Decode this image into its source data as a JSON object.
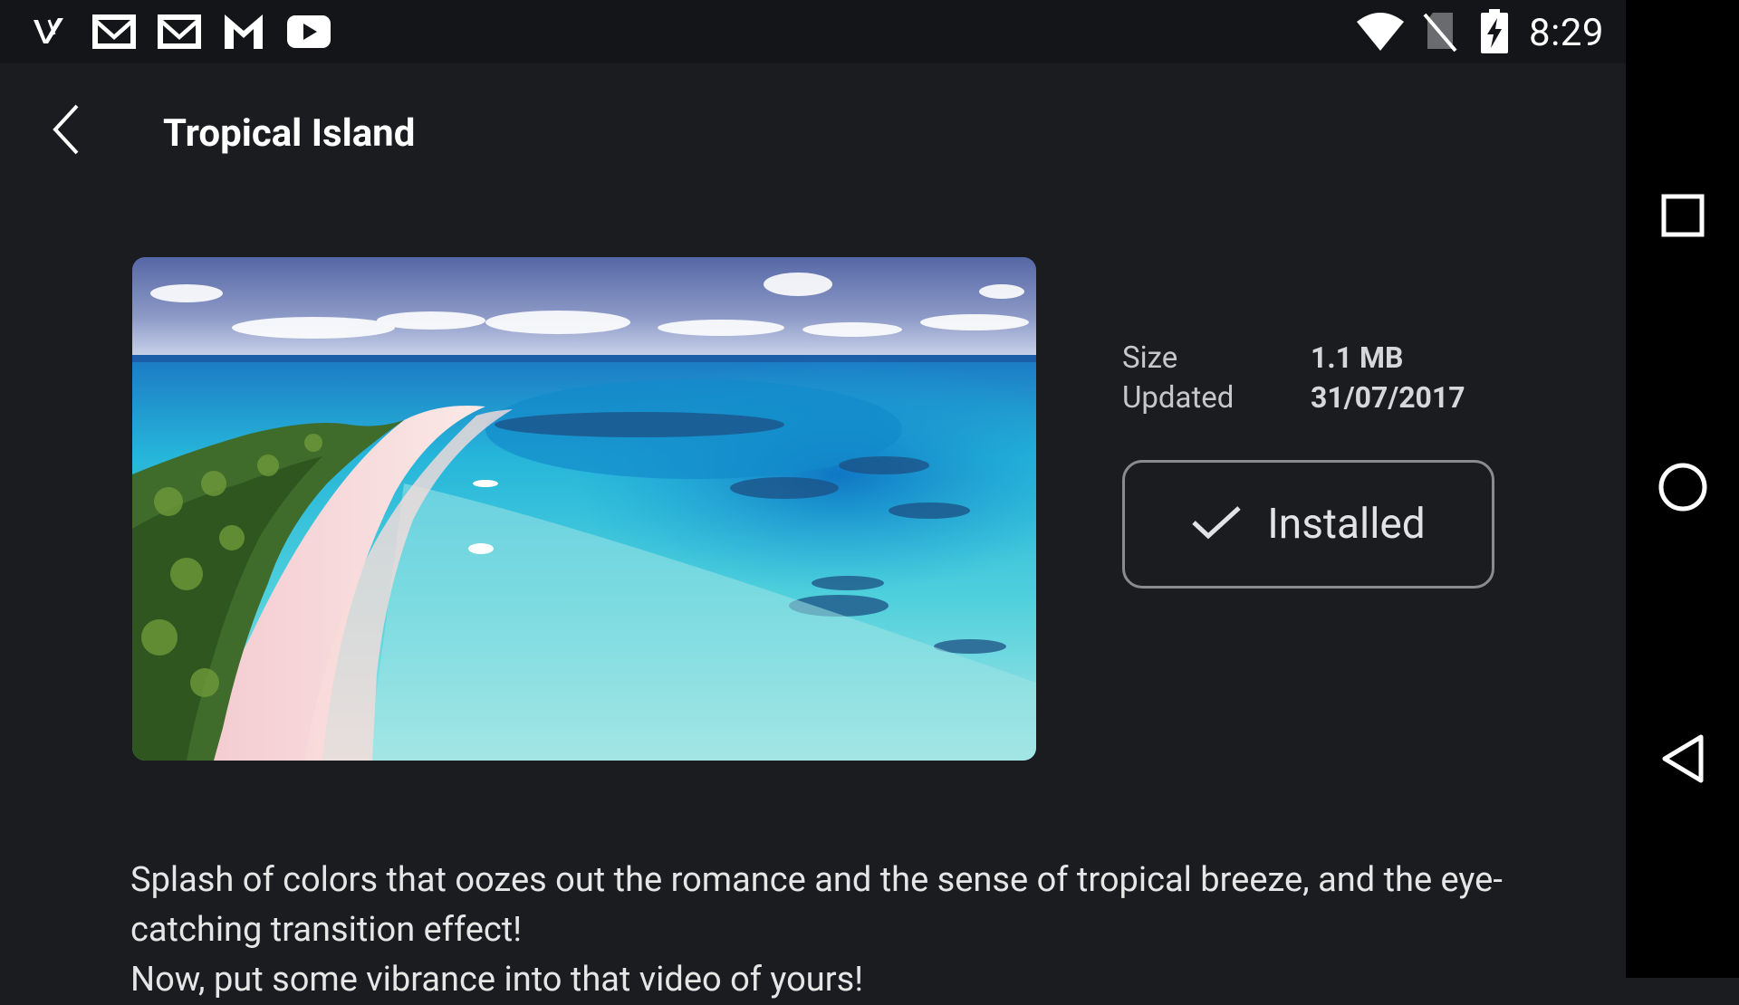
{
  "status_bar": {
    "time": "8:29",
    "left_icons": [
      "v-app-icon",
      "gmail-icon",
      "gmail-icon",
      "gmail-icon",
      "youtube-icon"
    ],
    "right_icons": [
      "wifi-icon",
      "no-sim-icon",
      "battery-charging-icon"
    ]
  },
  "app_bar": {
    "title": "Tropical Island",
    "back_icon": "chevron-left-icon"
  },
  "details": {
    "size_label": "Size",
    "size_value": "1.1 MB",
    "updated_label": "Updated",
    "updated_value": "31/07/2017"
  },
  "install_button": {
    "label": "Installed",
    "icon": "check-icon"
  },
  "description": {
    "line1": "Splash of colors that oozes out the romance and the sense of tropical breeze, and the eye-catching transition effect!",
    "line2": "Now, put some vibrance into that video of yours!"
  },
  "nav_bar": {
    "icons": [
      "recents-square-icon",
      "home-circle-icon",
      "back-triangle-icon"
    ]
  },
  "colors": {
    "background": "#1b1c1f",
    "status_bar": "#141518",
    "nav_bar": "#000000",
    "button_border": "#8a8b8e"
  }
}
